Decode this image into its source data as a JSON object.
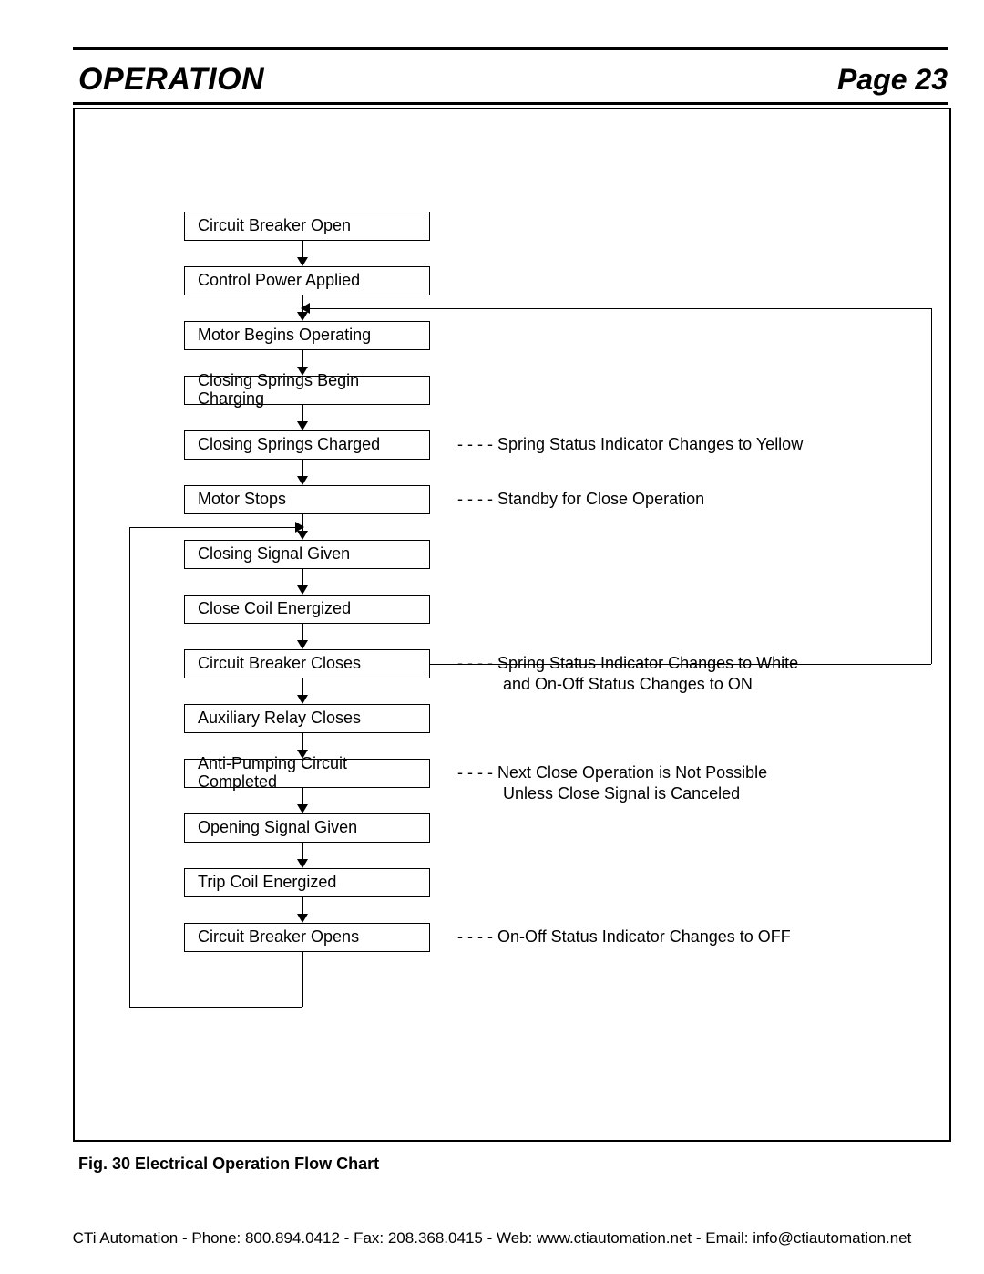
{
  "header": {
    "title": "OPERATION",
    "page_label": "Page 23"
  },
  "flowchart": {
    "boxes": [
      {
        "id": "b0",
        "label": "Circuit Breaker Open"
      },
      {
        "id": "b1",
        "label": "Control Power Applied"
      },
      {
        "id": "b2",
        "label": "Motor Begins Operating"
      },
      {
        "id": "b3",
        "label": "Closing Springs Begin Charging"
      },
      {
        "id": "b4",
        "label": "Closing Springs Charged"
      },
      {
        "id": "b5",
        "label": "Motor Stops"
      },
      {
        "id": "b6",
        "label": "Closing Signal Given"
      },
      {
        "id": "b7",
        "label": "Close Coil Energized"
      },
      {
        "id": "b8",
        "label": "Circuit Breaker Closes"
      },
      {
        "id": "b9",
        "label": "Auxiliary Relay Closes"
      },
      {
        "id": "b10",
        "label": "Anti-Pumping Circuit Completed"
      },
      {
        "id": "b11",
        "label": "Opening Signal Given"
      },
      {
        "id": "b12",
        "label": "Trip Coil Energized"
      },
      {
        "id": "b13",
        "label": "Circuit Breaker Opens"
      }
    ],
    "annotations": [
      {
        "for_box": "b4",
        "text": "- - - - Spring Status Indicator Changes to Yellow"
      },
      {
        "for_box": "b5",
        "text": "- - - - Standby for Close Operation"
      },
      {
        "for_box": "b8",
        "text": "- - - - Spring Status Indicator Changes to White\n          and On-Off Status Changes to ON"
      },
      {
        "for_box": "b10",
        "text": "- - - - Next Close Operation is Not Possible\n          Unless Close Signal is Canceled"
      },
      {
        "for_box": "b13",
        "text": "- - - - On-Off Status Indicator Changes to OFF"
      }
    ],
    "loops": [
      {
        "from_box": "b13",
        "to_box": "b6",
        "side": "left"
      },
      {
        "from_box": "b8",
        "to_box": "b2",
        "side": "right"
      }
    ]
  },
  "caption": "Fig. 30  Electrical Operation Flow Chart",
  "footer": "CTi Automation - Phone: 800.894.0412 - Fax: 208.368.0415 - Web: www.ctiautomation.net - Email: info@ctiautomation.net"
}
